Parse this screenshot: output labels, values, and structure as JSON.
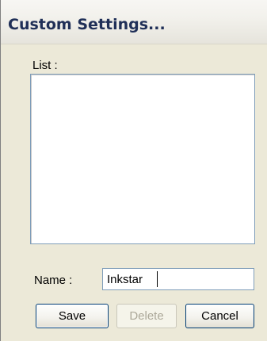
{
  "window": {
    "title": "Custom Settings..."
  },
  "list": {
    "label": "List :",
    "items": []
  },
  "name_field": {
    "label": "Name :",
    "value": "Inkstar"
  },
  "buttons": {
    "save": "Save",
    "delete": "Delete",
    "cancel": "Cancel",
    "delete_enabled": false
  }
}
